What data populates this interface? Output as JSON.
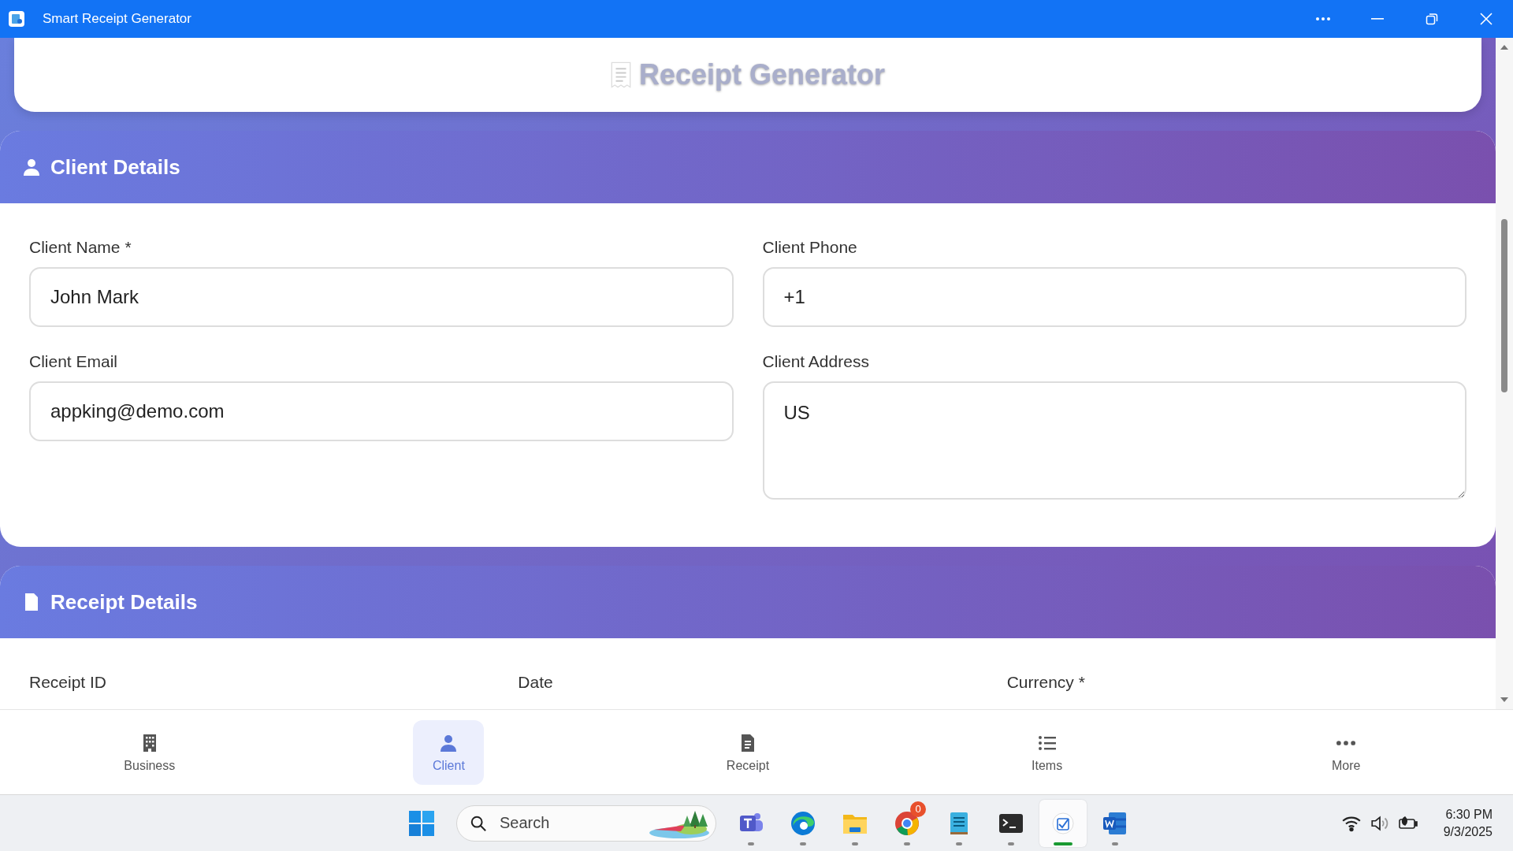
{
  "window": {
    "title": "Smart Receipt Generator"
  },
  "header": {
    "title": "Receipt Generator"
  },
  "sections": [
    {
      "title": "Client Details",
      "fields": [
        {
          "label": "Client Name *",
          "value": "John Mark",
          "kind": "input"
        },
        {
          "label": "Client Phone",
          "value": "+1",
          "kind": "input"
        },
        {
          "label": "Client Email",
          "value": "appking@demo.com",
          "kind": "input"
        },
        {
          "label": "Client Address",
          "value": "US",
          "kind": "textarea"
        }
      ]
    },
    {
      "title": "Receipt Details",
      "fields": [
        {
          "label": "Receipt ID",
          "kind": "label"
        },
        {
          "label": "Date",
          "kind": "label"
        },
        {
          "label": "Currency *",
          "kind": "label"
        }
      ]
    }
  ],
  "bottom_nav": [
    {
      "label": "Business",
      "selected": false
    },
    {
      "label": "Client",
      "selected": true
    },
    {
      "label": "Receipt",
      "selected": false
    },
    {
      "label": "Items",
      "selected": false
    },
    {
      "label": "More",
      "selected": false
    }
  ],
  "taskbar": {
    "search": {
      "placeholder": "Search"
    },
    "apps": [
      {
        "selected": false
      },
      {
        "selected": false
      },
      {
        "selected": false
      },
      {
        "selected": false,
        "badge": "0"
      },
      {
        "selected": false
      },
      {
        "selected": false
      },
      {
        "selected": true
      },
      {
        "selected": false
      }
    ],
    "time": "6:30 PM",
    "date": "9/3/2025"
  }
}
